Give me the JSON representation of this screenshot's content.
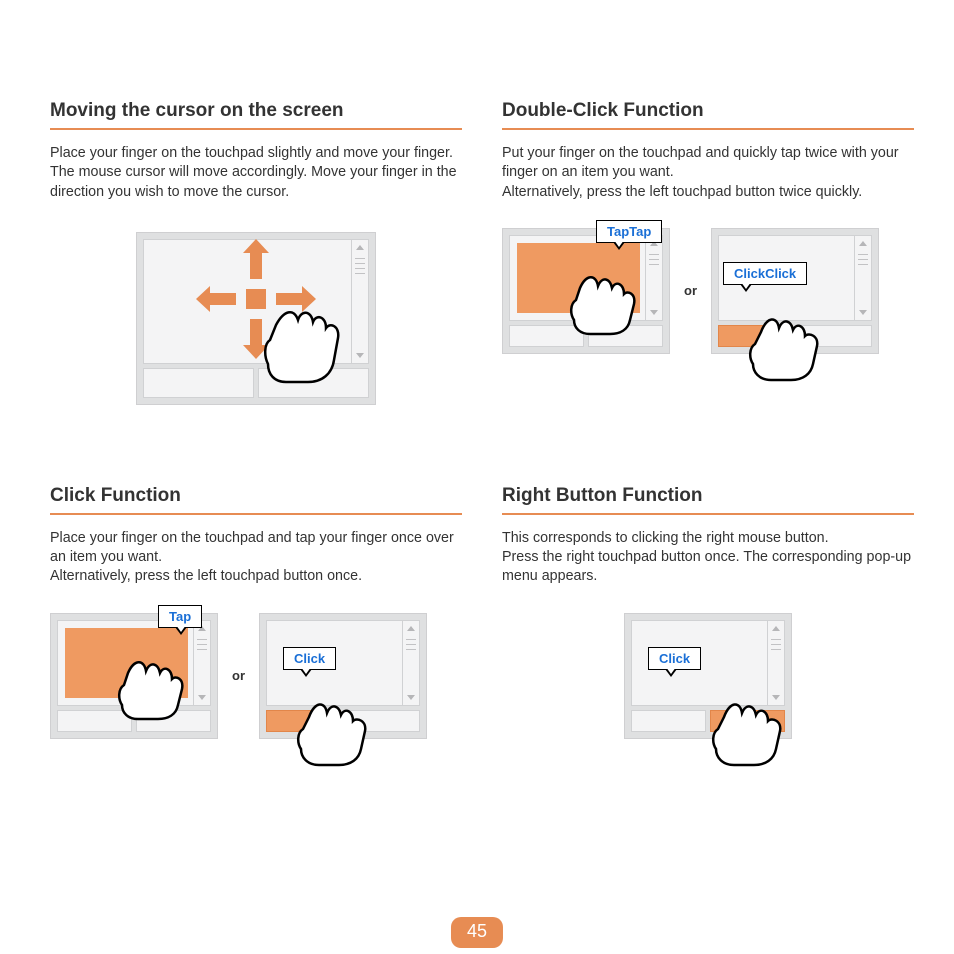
{
  "page_number": "45",
  "sections": {
    "move": {
      "heading": "Moving the cursor on the screen",
      "body": "Place your finger on the touchpad slightly and move your finger. The mouse cursor will move accordingly. Move your finger in the direction you wish to move the cursor."
    },
    "doubleclick": {
      "heading": "Double-Click Function",
      "body": "Put your finger on the touchpad and quickly tap twice with your finger on an item you want.\nAlternatively, press the left touchpad button twice quickly.",
      "callout_tap": "TapTap",
      "callout_click": "ClickClick",
      "or": "or"
    },
    "click": {
      "heading": "Click Function",
      "body": "Place your finger on the touchpad and tap your finger once over an item you want.\nAlternatively, press the left touchpad button once.",
      "callout_tap": "Tap",
      "callout_click": "Click",
      "or": "or"
    },
    "rightbutton": {
      "heading": "Right Button Function",
      "body": "This corresponds to clicking the right mouse button.\nPress the right touchpad button once. The corresponding pop-up menu appears.",
      "callout_click": "Click"
    }
  }
}
